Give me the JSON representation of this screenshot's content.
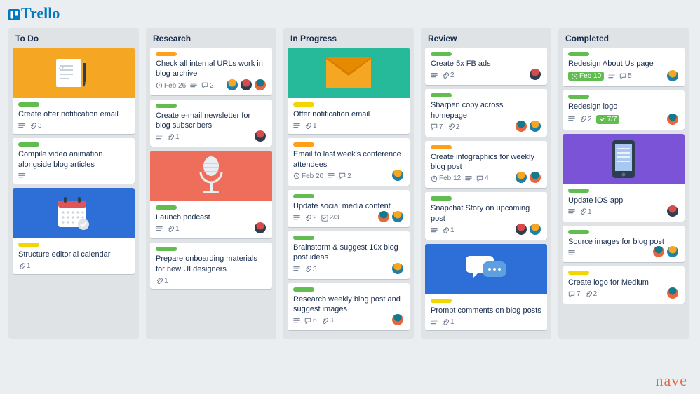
{
  "brand": "Trello",
  "watermark": "nave",
  "avatars": [
    "a",
    "b",
    "c"
  ],
  "lists": [
    {
      "title": "To Do",
      "cards": [
        {
          "cover": "doc",
          "coverColor": "#f5a623",
          "labels": [
            "green"
          ],
          "title": "Create offer notification email",
          "desc": true,
          "attach": "3"
        },
        {
          "labels": [
            "green"
          ],
          "title": "Compile video animation alongside blog articles",
          "desc": true
        },
        {
          "cover": "calendar",
          "coverColor": "#2d6fd6",
          "labels": [
            "yellow"
          ],
          "title": "Structure editorial calendar",
          "attach": "1"
        }
      ]
    },
    {
      "title": "Research",
      "cards": [
        {
          "labels": [
            "orange"
          ],
          "title": "Check all internal URLs work in blog archive",
          "due": "Feb 26",
          "desc": true,
          "comments": "2",
          "members": [
            "b",
            "a",
            "c"
          ]
        },
        {
          "labels": [
            "green"
          ],
          "title": "Create e-mail newsletter for blog subscribers",
          "desc": true,
          "attach": "1",
          "members": [
            "a"
          ]
        },
        {
          "cover": "mic",
          "coverColor": "#ee6e5b",
          "labels": [
            "green"
          ],
          "title": "Launch podcast",
          "desc": true,
          "attach": "1",
          "members": [
            "a"
          ]
        },
        {
          "labels": [
            "green"
          ],
          "title": "Prepare onboarding materials for new UI designers",
          "attach": "1"
        }
      ]
    },
    {
      "title": "In Progress",
      "cards": [
        {
          "cover": "mail",
          "coverColor": "#26b99a",
          "labels": [
            "yellow"
          ],
          "title": "Offer notification email",
          "desc": true,
          "attach": "1"
        },
        {
          "labels": [
            "orange"
          ],
          "title": "Email to last week's conference attendees",
          "due": "Feb 20",
          "desc": true,
          "comments": "2",
          "members": [
            "b"
          ]
        },
        {
          "labels": [
            "green"
          ],
          "title": "Update social media content",
          "desc": true,
          "attach": "2",
          "checklist": "2/3",
          "members": [
            "c",
            "b"
          ]
        },
        {
          "labels": [
            "green"
          ],
          "title": "Brainstorm & suggest 10x blog post ideas",
          "desc": true,
          "attach": "3",
          "members": [
            "b"
          ]
        },
        {
          "labels": [
            "green"
          ],
          "title": "Research weekly blog post and suggest images",
          "desc": true,
          "attach": "3",
          "comments": "6",
          "members": [
            "c"
          ]
        }
      ]
    },
    {
      "title": "Review",
      "cards": [
        {
          "labels": [
            "green"
          ],
          "title": "Create 5x FB ads",
          "desc": true,
          "attach": "2",
          "members": [
            "a"
          ]
        },
        {
          "labels": [
            "green"
          ],
          "title": "Sharpen copy across homepage",
          "comments": "7",
          "attach": "2",
          "members": [
            "c",
            "b"
          ]
        },
        {
          "labels": [
            "orange"
          ],
          "title": "Create infographics for weekly blog post",
          "due": "Feb 12",
          "desc": true,
          "comments": "4",
          "members": [
            "b",
            "c"
          ]
        },
        {
          "labels": [
            "green"
          ],
          "title": "Snapchat Story on upcoming post",
          "desc": true,
          "attach": "1",
          "members": [
            "a",
            "b"
          ]
        },
        {
          "cover": "chat",
          "coverColor": "#2d6fd6",
          "labels": [
            "yellow"
          ],
          "title": "Prompt comments on blog posts",
          "desc": true,
          "attach": "1"
        }
      ]
    },
    {
      "title": "Completed",
      "cards": [
        {
          "labels": [
            "green"
          ],
          "title": "Redesign About Us page",
          "dueDone": "Feb 10",
          "desc": true,
          "comments": "5",
          "members": [
            "b"
          ]
        },
        {
          "labels": [
            "green"
          ],
          "title": "Redesign logo",
          "desc": true,
          "attach": "2",
          "checkDone": "7/7",
          "members": [
            "c"
          ]
        },
        {
          "cover": "phone",
          "coverColor": "#7b53d6",
          "labels": [
            "green"
          ],
          "title": "Update iOS app",
          "desc": true,
          "attach": "1",
          "members": [
            "a"
          ]
        },
        {
          "labels": [
            "green"
          ],
          "title": "Source images for blog post",
          "desc": true,
          "members": [
            "c",
            "b"
          ]
        },
        {
          "labels": [
            "yellow"
          ],
          "title": "Create logo for Medium",
          "comments": "7",
          "attach": "2",
          "members": [
            "c"
          ]
        }
      ]
    }
  ]
}
